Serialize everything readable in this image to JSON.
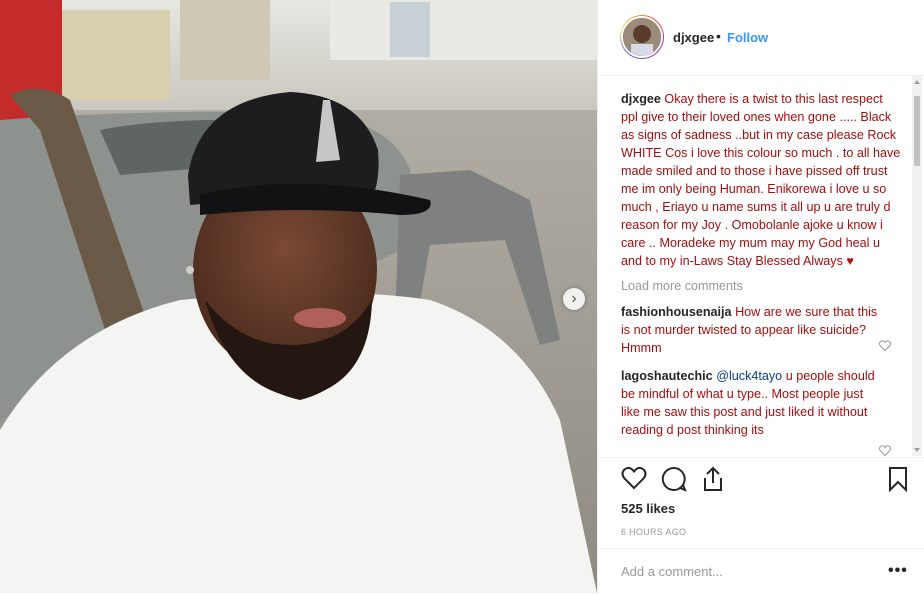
{
  "post": {
    "username": "djxgee",
    "follow_label": "Follow",
    "separator": "•",
    "caption": "Okay there is a twist to this last respect ppl give to their loved ones when gone ..... Black as signs of sadness ..but in my case please Rock WHITE Cos i love this colour so much . to all have made smiled and to those i have pissed off trust me im only being Human. Enikorewa i love u so much , Eriayo u name sums it all up u are truly d reason for my Joy . Omobolanle ajoke u know i care .. Moradeke my mum may my God heal u and to my in-Laws Stay Blessed Always",
    "caption_emoji": "♥",
    "load_more_label": "Load more comments",
    "likes": "525 likes",
    "timestamp": "6 HOURS AGO",
    "add_comment_placeholder": "Add a comment...",
    "more_label": "•••"
  },
  "comments": [
    {
      "username": "fashionhousenaija",
      "text": "How are we sure that this is not murder twisted to appear like suicide? Hmmm"
    },
    {
      "username": "lagoshautechic",
      "mention": "@luck4tayo",
      "text": "u people should be mindful of what u type.. Most people just like me saw this post and just liked it without reading d post thinking its"
    }
  ],
  "icons": {
    "like": "heart-icon",
    "comment": "comment-icon",
    "share": "share-icon",
    "save": "bookmark-icon",
    "comment_like": "heart-outline-icon",
    "carousel_next": "chevron-right-icon"
  },
  "colors": {
    "caption_text": "#a50e0e",
    "follow": "#3897f0",
    "emoji": "#b0121c"
  }
}
